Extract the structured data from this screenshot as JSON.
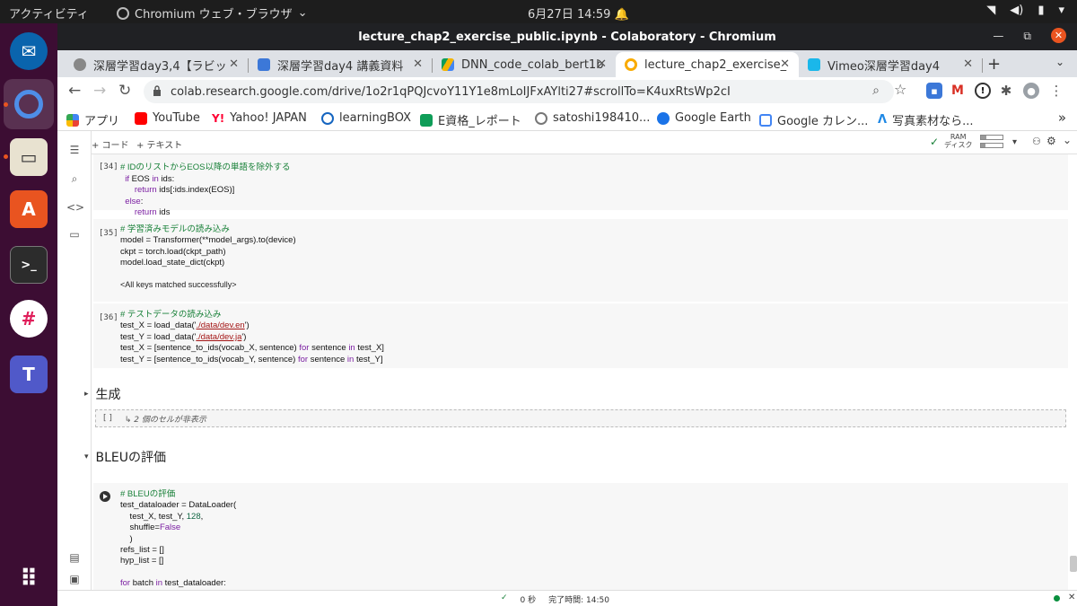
{
  "topbar": {
    "activities": "アクティビティ",
    "app_name": "Chromium ウェブ・ブラウザ",
    "app_chevron": "⌄",
    "clock": "6月27日  14:59",
    "bell": "♫"
  },
  "window": {
    "title": "lecture_chap2_exercise_public.ipynb - Colaboratory - Chromium",
    "minimize": "—",
    "maximize": "⧉",
    "close": "✕"
  },
  "tabs": [
    {
      "label": "深層学習day3,4【ラビッ",
      "color": "#888888"
    },
    {
      "label": "深層学習day4 講義資料",
      "color": "#3c78d8"
    },
    {
      "label": "DNN_code_colab_bert1b",
      "color": "#34a853"
    },
    {
      "label": "lecture_chap2_exercise_",
      "color": "#f9ab00"
    },
    {
      "label": "Vimeo深層学習day4",
      "color": "#1ab7ea"
    }
  ],
  "tab_close": "✕",
  "new_tab": "+",
  "tab_menu": "⌄",
  "nav": {
    "back": "←",
    "forward": "→",
    "reload": "↻"
  },
  "address": {
    "url": "colab.research.google.com/drive/1o2r1qPQJcvoY11Y1e8mLoIJFxAYlti27#scrollTo=K4uxRtsWp2cI",
    "zoom_icon": "⌕",
    "star": "☆"
  },
  "bookmarks": [
    {
      "label": "アプリ",
      "color": "#4285f4"
    },
    {
      "label": "YouTube",
      "color": "#ff0000"
    },
    {
      "label": "Yahoo! JAPAN",
      "color": "#ff0033"
    },
    {
      "label": "learningBOX",
      "color": "#1565c0"
    },
    {
      "label": "E資格_レポート",
      "color": "#0f9d58"
    },
    {
      "label": "satoshi198410...",
      "color": "#777777"
    },
    {
      "label": "Google Earth",
      "color": "#1a73e8"
    },
    {
      "label": "Google カレン...",
      "color": "#4285f4"
    },
    {
      "label": "写真素材なら...",
      "color": "#1e88e5"
    }
  ],
  "bookmarks_more": "»",
  "colab_toolbar": {
    "add_code": "+ コード",
    "add_text": "+ テキスト",
    "ram_label": "RAM",
    "disk_label": "ディスク",
    "ram_fraction": 0.25,
    "disk_fraction": 0.2,
    "check": "✓"
  },
  "cells": [
    {
      "number": "[34]"
    },
    {
      "number": "[35]",
      "output": "<All keys matched successfully>"
    },
    {
      "number": "[36]"
    },
    {
      "number": ""
    }
  ],
  "code": {
    "c34": [
      "# IDのリストからEOS以降の単語を除外する",
      "if EOS in ids:",
      "    return ids[:ids.index(EOS)]",
      "else:",
      "    return ids"
    ],
    "c35": [
      "# 学習済みモデルの読み込み",
      "model = Transformer(**model_args).to(device)",
      "ckpt = torch.load(ckpt_path)",
      "model.load_state_dict(ckpt)"
    ],
    "c36": [
      "# テストデータの読み込み",
      "test_X = load_data('./data/dev.en')",
      "test_Y = load_data('./data/dev.ja')",
      "test_X = [sentence_to_ids(vocab_X, sentence) for sentence in test_X]",
      "test_Y = [sentence_to_ids(vocab_Y, sentence) for sentence in test_Y]"
    ],
    "c37": [
      "# BLEUの評価",
      "test_dataloader = DataLoader(",
      "    test_X, test_Y, 128,",
      "    shuffle=False",
      "    )",
      "refs_list = []",
      "hyp_list = []",
      "",
      "for batch in test_dataloader:"
    ]
  },
  "sections": {
    "generate": "生成",
    "bleu": "BLEUの評価",
    "arrow_collapsed": "▸",
    "arrow_expanded": "▾"
  },
  "hidden_cells": {
    "brackets": "[ ]",
    "text": "↳ 2 個のセルが非表示"
  },
  "status": {
    "check": "✓",
    "elapsed": "0 秒",
    "done": "完了時間: 14:50",
    "close": "✕"
  }
}
